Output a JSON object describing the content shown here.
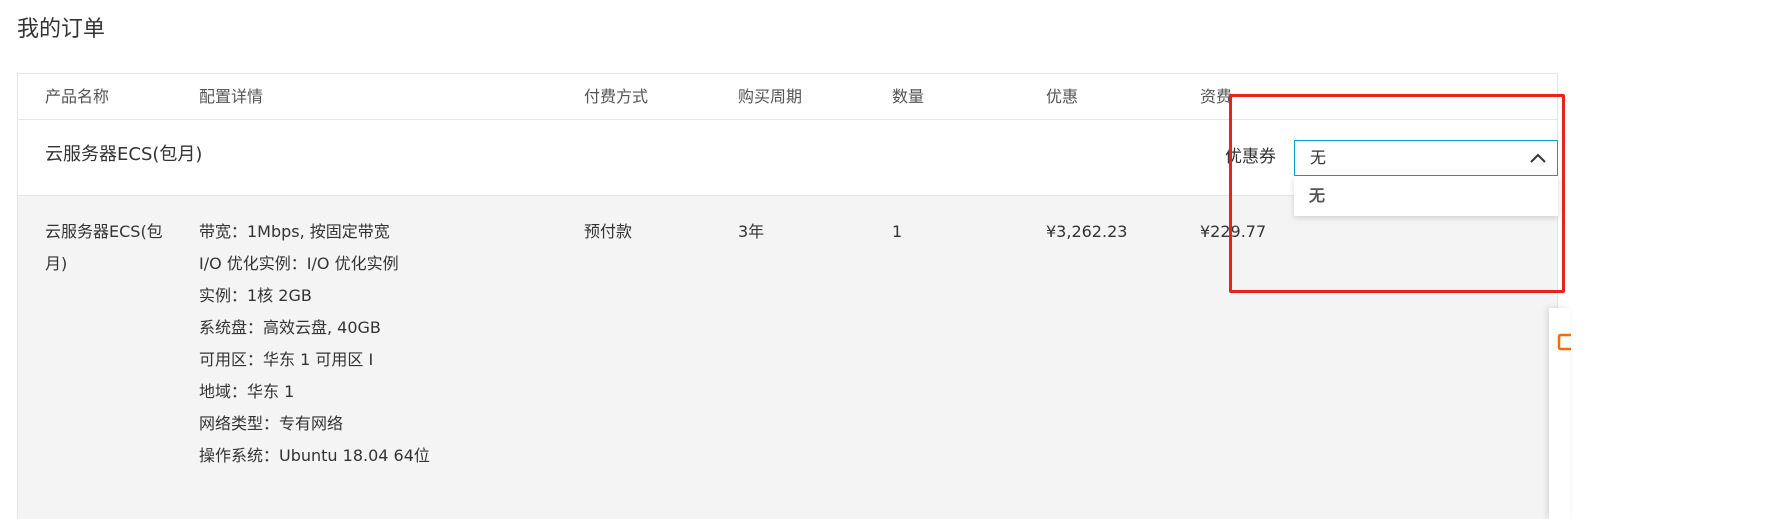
{
  "page": {
    "title": "我的订单"
  },
  "table": {
    "headers": {
      "product": "产品名称",
      "config": "配置详情",
      "payment": "付费方式",
      "period": "购买周期",
      "quantity": "数量",
      "discount": "优惠",
      "fee": "资费"
    },
    "group": {
      "name": "云服务器ECS(包月)",
      "coupon_label": "优惠券",
      "coupon_select": {
        "value": "无",
        "options": [
          "无"
        ]
      }
    },
    "row": {
      "product": "云服务器ECS(包月)",
      "config": [
        "带宽：1Mbps, 按固定带宽",
        "I/O 优化实例：I/O 优化实例",
        "实例：1核 2GB",
        "系统盘：高效云盘, 40GB",
        "可用区：华东 1 可用区 I",
        "地域：华东 1",
        "网络类型：专有网络",
        "操作系统：Ubuntu 18.04 64位"
      ],
      "payment": "预付款",
      "period": "3年",
      "quantity": "1",
      "discount": "¥3,262.23",
      "fee": "¥229.77"
    }
  },
  "colors": {
    "highlight": "#e8231a",
    "select_border": "#00a2ca",
    "side_widget_accent": "#ff6a00"
  },
  "icons": {
    "select_chevron": "chevron-up-icon",
    "side_widget": "widget-icon"
  }
}
